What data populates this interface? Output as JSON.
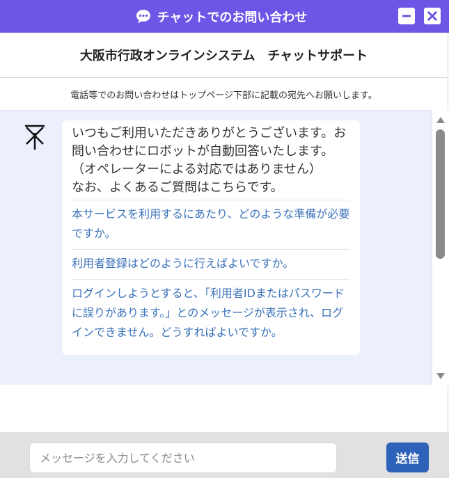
{
  "window": {
    "title": "チャットでのお問い合わせ",
    "icons": {
      "chat": "chat-bubble-icon",
      "minimize": "minimize-icon",
      "close": "close-icon"
    },
    "accent_color": "#6b56e6"
  },
  "header": {
    "title": "大阪市行政オンラインシステム　チャットサポート"
  },
  "notice": {
    "text": "電話等でのお問い合わせはトップページ下部に記載の宛先へお願いします。"
  },
  "chat": {
    "bot_icon": "bot-avatar-icon",
    "messages": [
      {
        "text": "いつもご利用いただきありがとうございます。お問い合わせにロボットが自動回答いたします。（オペレーターによる対応ではありません）\nなお、よくあるご質問はこちらです。",
        "faq_links": [
          "本サービスを利用するにあたり、どのような準備が必要ですか。",
          "利用者登録はどのように行えばよいですか。",
          "ログインしようとすると、「利用者IDまたはパスワードに誤りがあります。」とのメッセージが表示され、ログインできません。どうすればよいですか。"
        ]
      }
    ],
    "link_color": "#3a72ba"
  },
  "input": {
    "placeholder": "メッセージを入力してください",
    "value": "",
    "send_label": "送信",
    "send_color": "#2e62b8"
  }
}
